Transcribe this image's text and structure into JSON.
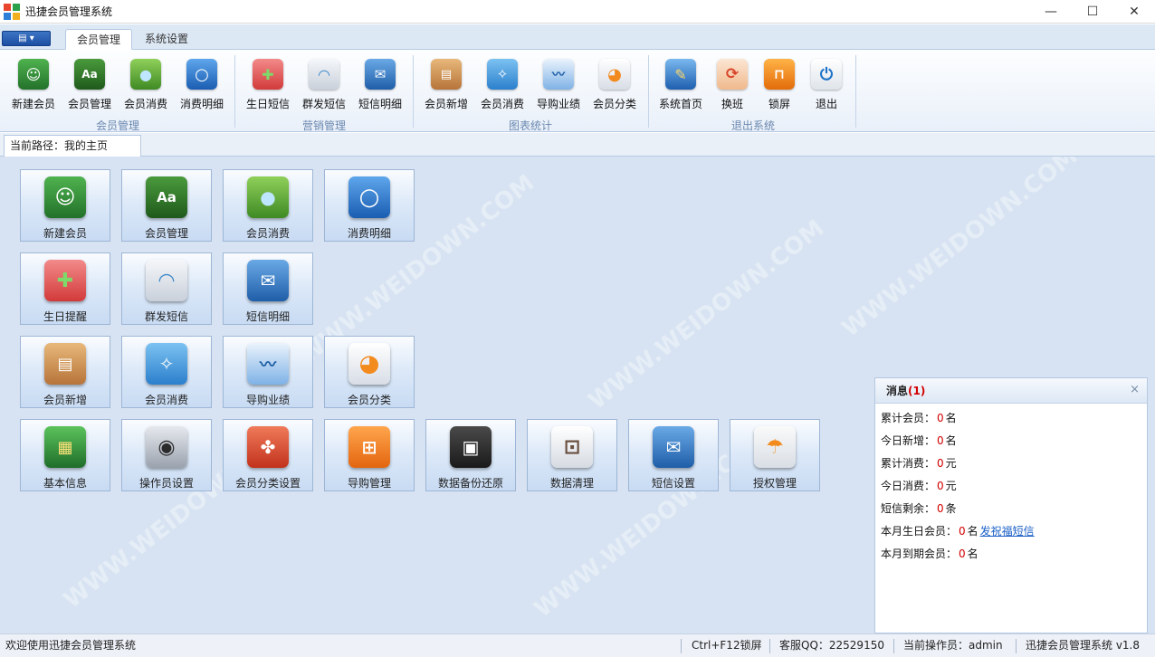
{
  "window": {
    "title": "迅捷会员管理系统",
    "minimize": "—",
    "maximize": "☐",
    "close": "✕"
  },
  "tabs": [
    {
      "label": "会员管理",
      "active": true
    },
    {
      "label": "系统设置",
      "active": false
    }
  ],
  "menu_button": "▤ ▾",
  "ribbon": {
    "groups": [
      {
        "label": "会员管理",
        "items": [
          {
            "label": "新建会员",
            "icon": "member-book-icon"
          },
          {
            "label": "会员管理",
            "icon": "address-book-icon"
          },
          {
            "label": "会员消费",
            "icon": "water-drop-icon"
          },
          {
            "label": "消费明细",
            "icon": "magnifier-icon"
          }
        ]
      },
      {
        "label": "营销管理",
        "items": [
          {
            "label": "生日短信",
            "icon": "gift-icon"
          },
          {
            "label": "群发短信",
            "icon": "wifi-icon"
          },
          {
            "label": "短信明细",
            "icon": "mail-icon"
          }
        ]
      },
      {
        "label": "图表统计",
        "items": [
          {
            "label": "会员新增",
            "icon": "box-icon"
          },
          {
            "label": "会员消费",
            "icon": "network-icon"
          },
          {
            "label": "导购业绩",
            "icon": "line-chart-icon"
          },
          {
            "label": "会员分类",
            "icon": "pie-chart-icon"
          }
        ]
      },
      {
        "label": "退出系统",
        "items": [
          {
            "label": "系统首页",
            "icon": "home-icon"
          },
          {
            "label": "换班",
            "icon": "refresh-icon"
          },
          {
            "label": "锁屏",
            "icon": "lock-icon"
          },
          {
            "label": "退出",
            "icon": "power-icon"
          }
        ]
      }
    ]
  },
  "breadcrumb": "当前路径：我的主页",
  "tiles": [
    [
      {
        "label": "新建会员",
        "icon": "member-book-icon"
      },
      {
        "label": "会员管理",
        "icon": "address-book-icon"
      },
      {
        "label": "会员消费",
        "icon": "water-drop-icon"
      },
      {
        "label": "消费明细",
        "icon": "magnifier-icon"
      }
    ],
    [
      {
        "label": "生日提醒",
        "icon": "gift-icon"
      },
      {
        "label": "群发短信",
        "icon": "wifi-icon"
      },
      {
        "label": "短信明细",
        "icon": "mail-icon"
      }
    ],
    [
      {
        "label": "会员新增",
        "icon": "box-icon"
      },
      {
        "label": "会员消费",
        "icon": "network-icon"
      },
      {
        "label": "导购业绩",
        "icon": "line-chart-icon"
      },
      {
        "label": "会员分类",
        "icon": "pie-chart-icon"
      }
    ],
    [
      {
        "label": "基本信息",
        "icon": "circuit-board-icon"
      },
      {
        "label": "操作员设置",
        "icon": "gamepad-icon"
      },
      {
        "label": "会员分类设置",
        "icon": "puzzle-icon"
      },
      {
        "label": "导购管理",
        "icon": "org-chart-icon"
      },
      {
        "label": "数据备份还原",
        "icon": "floppy-disk-icon"
      },
      {
        "label": "数据清理",
        "icon": "shopping-cart-icon"
      },
      {
        "label": "短信设置",
        "icon": "envelope-icon"
      },
      {
        "label": "授权管理",
        "icon": "umbrella-icon"
      }
    ]
  ],
  "messages": {
    "title": "消息",
    "count": "(1)",
    "close": "×",
    "rows": [
      {
        "label": "累计会员：",
        "value": "0",
        "unit": "名"
      },
      {
        "label": "今日新增：",
        "value": "0",
        "unit": "名"
      },
      {
        "label": "累计消费：",
        "value": "0",
        "unit": "元"
      },
      {
        "label": "今日消费：",
        "value": "0",
        "unit": "元"
      },
      {
        "label": "短信剩余：",
        "value": "0",
        "unit": "条"
      },
      {
        "label": "本月生日会员：",
        "value": "0",
        "unit": "名",
        "link": "发祝福短信"
      },
      {
        "label": "本月到期会员：",
        "value": "0",
        "unit": "名"
      }
    ]
  },
  "status": {
    "welcome": "欢迎使用迅捷会员管理系统",
    "shortcut": "Ctrl+F12锁屏",
    "qq": "客服QQ：22529150",
    "operator": "当前操作员：admin",
    "version": "迅捷会员管理系统 v1.8"
  },
  "watermark": "WWW.WEIDOWN.COM"
}
